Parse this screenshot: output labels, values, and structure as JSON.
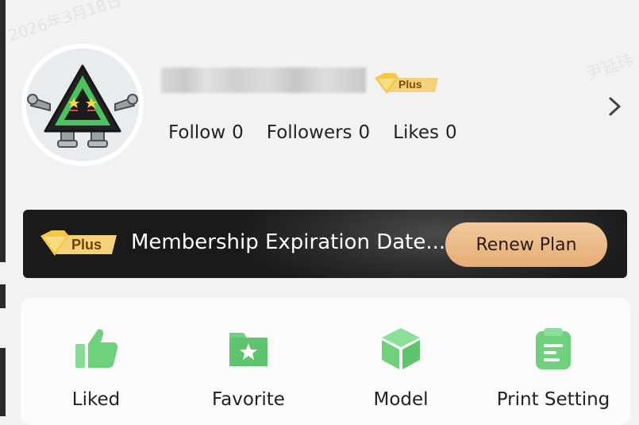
{
  "watermarks": [
    "2026年3月18日",
    "尹延玮"
  ],
  "profile": {
    "badge": "Plus",
    "stats": [
      {
        "label": "Follow",
        "count": "0"
      },
      {
        "label": "Followers",
        "count": "0"
      },
      {
        "label": "Likes",
        "count": "0"
      }
    ]
  },
  "membership": {
    "badge": "Plus",
    "text": "Membership Expiration Date...",
    "button": "Renew Plan"
  },
  "shortcuts": [
    {
      "label": "Liked",
      "icon": "thumbs-up-icon"
    },
    {
      "label": "Favorite",
      "icon": "star-folder-icon"
    },
    {
      "label": "Model",
      "icon": "cube-icon"
    },
    {
      "label": "Print Setting",
      "icon": "clipboard-icon"
    }
  ],
  "colors": {
    "accent_green": "#6fd07d",
    "gold": "#f3c94a",
    "renew_button": "#edb985",
    "banner_bg": "#262626"
  }
}
